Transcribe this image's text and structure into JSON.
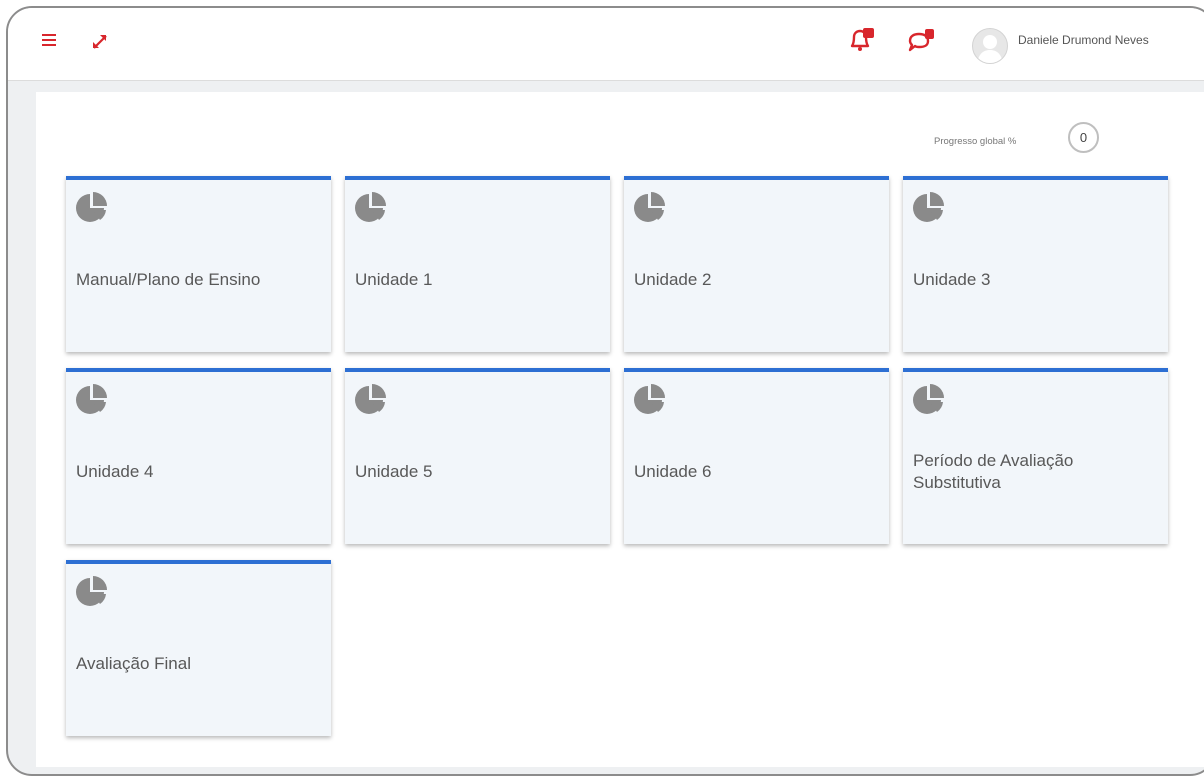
{
  "header": {
    "user_name": "Daniele Drumond Neves",
    "icons": [
      "menu-icon",
      "expand-icon",
      "notifications-bell-icon",
      "messages-chat-icon"
    ],
    "accent_color": "#d8262c"
  },
  "progress": {
    "label": "Progresso global %",
    "value": "0"
  },
  "cards": [
    {
      "title": "Manual/Plano de Ensino"
    },
    {
      "title": "Unidade 1"
    },
    {
      "title": "Unidade 2"
    },
    {
      "title": "Unidade 3"
    },
    {
      "title": "Unidade 4"
    },
    {
      "title": "Unidade 5"
    },
    {
      "title": "Unidade 6"
    },
    {
      "title": "Período de Avaliação Substitutiva"
    },
    {
      "title": "Avaliação Final"
    }
  ],
  "card_icon": "pie-chart-icon",
  "card_accent_color": "#2d6fd3"
}
